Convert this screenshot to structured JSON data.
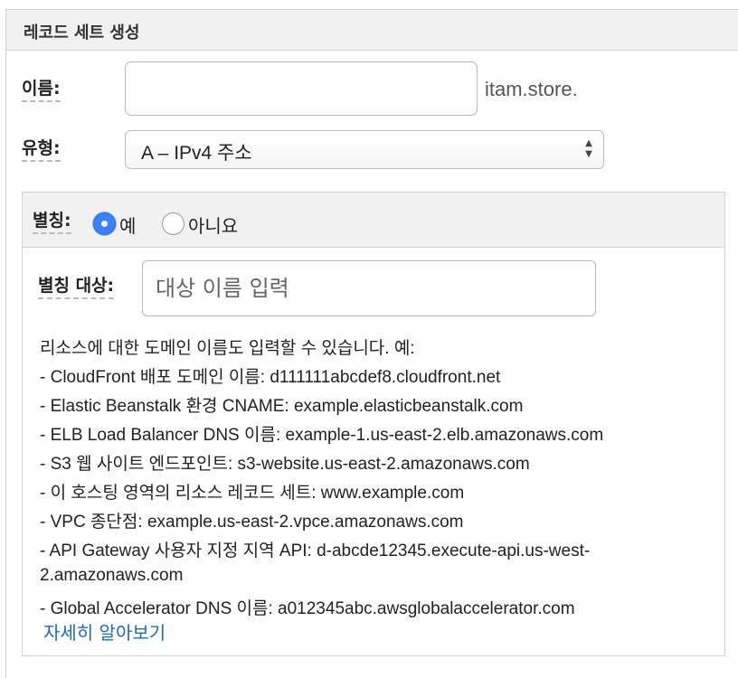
{
  "panel": {
    "title": "레코드 세트 생성"
  },
  "name_field": {
    "label": "이름:",
    "value": "",
    "placeholder": "",
    "suffix": "itam.store."
  },
  "type_field": {
    "label": "유형:",
    "selected": "A – IPv4 주소"
  },
  "alias": {
    "label": "별칭:",
    "options": [
      {
        "label": "예",
        "selected": true
      },
      {
        "label": "아니요",
        "selected": false
      }
    ],
    "target_label": "별칭 대상:",
    "target_placeholder": "대상 이름 입력",
    "info_intro": "리소스에 대한 도메인 이름도 입력할 수 있습니다. 예:",
    "info_lines": [
      "-  CloudFront 배포 도메인 이름: d111111abcdef8.cloudfront.net",
      "-  Elastic Beanstalk 환경 CNAME: example.elasticbeanstalk.com",
      "-  ELB Load Balancer DNS 이름: example-1.us-east-2.elb.amazonaws.com",
      "-  S3 웹 사이트 엔드포인트: s3-website.us-east-2.amazonaws.com",
      "-  이 호스팅 영역의 리소스 레코드 세트: www.example.com",
      "-  VPC 종단점: example.us-east-2.vpce.amazonaws.com",
      "-  API Gateway 사용자 지정 지역 API: d-abcde12345.execute-api.us-west-",
      "2.amazonaws.com",
      "-  Global Accelerator DNS 이름: a012345abc.awsglobalaccelerator.com"
    ],
    "learn_more": "자세히 알아보기"
  },
  "colors": {
    "accent": "#3b82f6",
    "link": "#1b6ac9",
    "header_bg": "#f1f1f1"
  }
}
